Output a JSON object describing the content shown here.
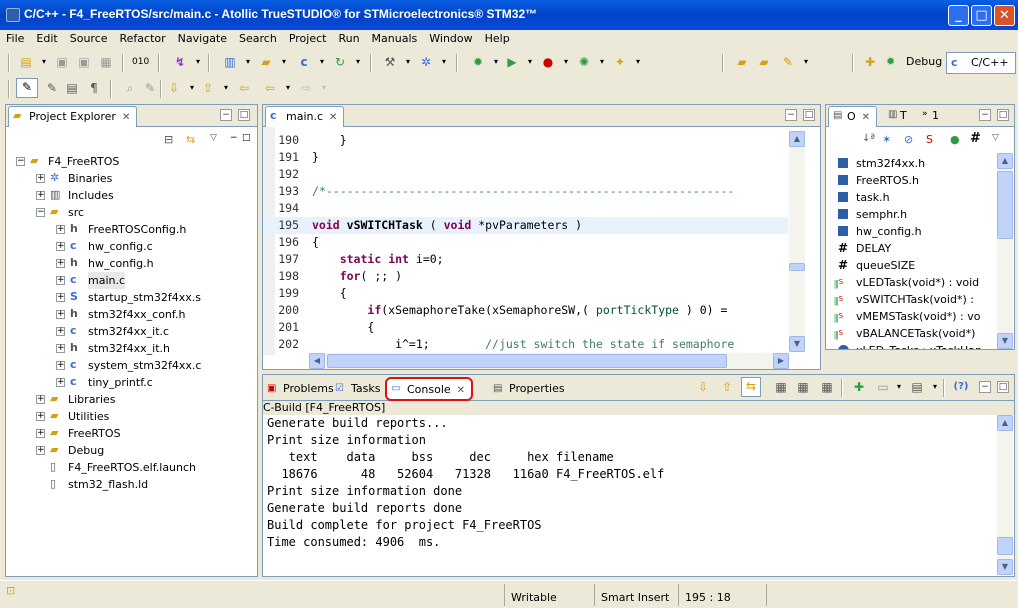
{
  "window": {
    "title": "C/C++ - F4_FreeRTOS/src/main.c - Atollic TrueSTUDIO® for STMicroelectronics® STM32™",
    "minimize": "_",
    "maximize": "□",
    "close": "✕"
  },
  "menu": [
    "File",
    "Edit",
    "Source",
    "Refactor",
    "Navigate",
    "Search",
    "Project",
    "Run",
    "Manuals",
    "Window",
    "Help"
  ],
  "perspectives": {
    "debug": "Debug",
    "cpp": "C/C++"
  },
  "project_explorer": {
    "tab_label": "Project Explorer",
    "close": "✕",
    "items": [
      {
        "label": "F4_FreeRTOS",
        "depth": 0,
        "exp": "−",
        "icon": "project-folder"
      },
      {
        "label": "Binaries",
        "depth": 1,
        "exp": "+",
        "icon": "binaries"
      },
      {
        "label": "Includes",
        "depth": 1,
        "exp": "+",
        "icon": "includes"
      },
      {
        "label": "src",
        "depth": 1,
        "exp": "−",
        "icon": "folder"
      },
      {
        "label": "FreeRTOSConfig.h",
        "depth": 2,
        "exp": "+",
        "icon": "h-file"
      },
      {
        "label": "hw_config.c",
        "depth": 2,
        "exp": "+",
        "icon": "c-file"
      },
      {
        "label": "hw_config.h",
        "depth": 2,
        "exp": "+",
        "icon": "h-file"
      },
      {
        "label": "main.c",
        "depth": 2,
        "exp": "+",
        "icon": "c-file"
      },
      {
        "label": "startup_stm32f4xx.s",
        "depth": 2,
        "exp": "+",
        "icon": "s-file"
      },
      {
        "label": "stm32f4xx_conf.h",
        "depth": 2,
        "exp": "+",
        "icon": "h-file"
      },
      {
        "label": "stm32f4xx_it.c",
        "depth": 2,
        "exp": "+",
        "icon": "c-file"
      },
      {
        "label": "stm32f4xx_it.h",
        "depth": 2,
        "exp": "+",
        "icon": "h-file"
      },
      {
        "label": "system_stm32f4xx.c",
        "depth": 2,
        "exp": "+",
        "icon": "c-file"
      },
      {
        "label": "tiny_printf.c",
        "depth": 2,
        "exp": "+",
        "icon": "c-file"
      },
      {
        "label": "Libraries",
        "depth": 1,
        "exp": "+",
        "icon": "folder"
      },
      {
        "label": "Utilities",
        "depth": 1,
        "exp": "+",
        "icon": "folder"
      },
      {
        "label": "FreeRTOS",
        "depth": 1,
        "exp": "+",
        "icon": "folder"
      },
      {
        "label": "Debug",
        "depth": 1,
        "exp": "+",
        "icon": "folder"
      },
      {
        "label": "F4_FreeRTOS.elf.launch",
        "depth": 1,
        "exp": "",
        "icon": "file"
      },
      {
        "label": "stm32_flash.ld",
        "depth": 1,
        "exp": "",
        "icon": "file"
      }
    ]
  },
  "editor": {
    "tab_label": "main.c",
    "close": "✕",
    "lines": [
      {
        "n": "190",
        "html": "    }"
      },
      {
        "n": "191",
        "html": "}"
      },
      {
        "n": "192",
        "html": ""
      },
      {
        "n": "193",
        "html": "<span class=\"cm\">/*-----------------------------------------------------------</span>"
      },
      {
        "n": "194",
        "html": ""
      },
      {
        "n": "195",
        "html": "<span class=\"kw\">void</span> <b>vSWITCHTask</b> ( <span class=\"kw\">void</span> *pvParameters )"
      },
      {
        "n": "196",
        "html": "{"
      },
      {
        "n": "197",
        "html": "    <span class=\"kw\">static</span> <span class=\"kw\">int</span> i=0;"
      },
      {
        "n": "198",
        "html": "    <span class=\"kw\">for</span>( ;; )"
      },
      {
        "n": "199",
        "html": "    {"
      },
      {
        "n": "200",
        "html": "        <span class=\"kw\">if</span>(xSemaphoreTake(xSemaphoreSW,( <span class=\"ty\">portTickType</span> ) 0) ="
      },
      {
        "n": "201",
        "html": "        {"
      },
      {
        "n": "202",
        "html": "            i^=1;        <span class=\"cm\">//just switch the state if semaphore</span>"
      }
    ]
  },
  "outline": {
    "tab_o": "O",
    "tab_t": "T",
    "tab_1": "1",
    "close": "✕",
    "items": [
      {
        "label": "stm32f4xx.h",
        "icon": "include"
      },
      {
        "label": "FreeRTOS.h",
        "icon": "include"
      },
      {
        "label": "task.h",
        "icon": "include"
      },
      {
        "label": "semphr.h",
        "icon": "include"
      },
      {
        "label": "hw_config.h",
        "icon": "include"
      },
      {
        "label": "DELAY",
        "icon": "macro"
      },
      {
        "label": "queueSIZE",
        "icon": "macro"
      },
      {
        "label": "vLEDTask(void*) : void",
        "icon": "function"
      },
      {
        "label": "vSWITCHTask(void*) :",
        "icon": "function"
      },
      {
        "label": "vMEMSTask(void*) : vo",
        "icon": "function"
      },
      {
        "label": "vBALANCETask(void*)",
        "icon": "function"
      },
      {
        "label": "xLED_Tasks : xTaskHan",
        "icon": "variable"
      }
    ]
  },
  "bottom": {
    "tabs": [
      {
        "label": "Problems",
        "icon": "problems"
      },
      {
        "label": "Tasks",
        "icon": "tasks"
      },
      {
        "label": "Console",
        "icon": "console"
      },
      {
        "label": "Properties",
        "icon": "properties"
      }
    ],
    "close": "✕",
    "console_title": "C-Build [F4_FreeRTOS]",
    "console_lines": [
      "Generate build reports...",
      "Print size information",
      "   text    data     bss     dec     hex filename",
      "  18676      48   52604   71328   116a0 F4_FreeRTOS.elf",
      "Print size information done",
      "Generate build reports done",
      "Build complete for project F4_FreeRTOS",
      "Time consumed: 4906  ms."
    ]
  },
  "status": {
    "writable": "Writable",
    "insert": "Smart Insert",
    "position": "195 : 18"
  }
}
